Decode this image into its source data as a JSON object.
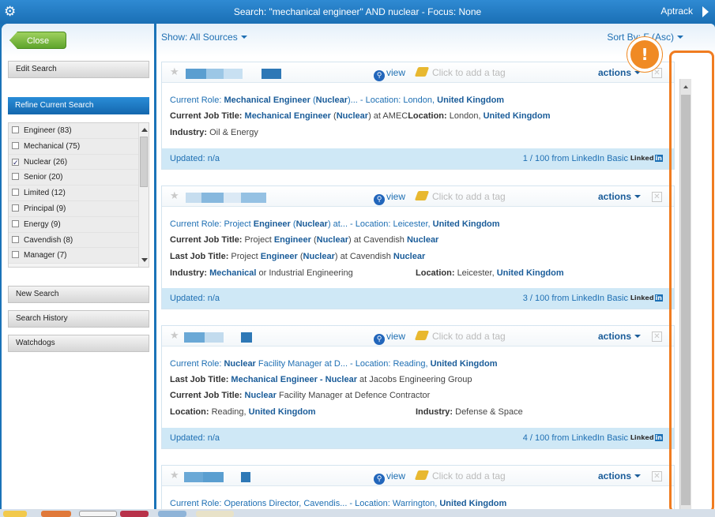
{
  "titlebar": {
    "title": "Search: \"mechanical engineer\" AND nuclear - Focus: None",
    "brand": "Aptrack"
  },
  "sidebar": {
    "close_label": "Close",
    "edit_search": "Edit Search",
    "refine_search": "Refine Current Search",
    "facets": [
      {
        "label": "Engineer (83)",
        "checked": false
      },
      {
        "label": "Mechanical (75)",
        "checked": false
      },
      {
        "label": "Nuclear (26)",
        "checked": true
      },
      {
        "label": "Senior (20)",
        "checked": false
      },
      {
        "label": "Limited (12)",
        "checked": false
      },
      {
        "label": "Principal (9)",
        "checked": false
      },
      {
        "label": "Energy (9)",
        "checked": false
      },
      {
        "label": "Cavendish (8)",
        "checked": false
      },
      {
        "label": "Manager (7)",
        "checked": false
      }
    ],
    "new_search": "New Search",
    "search_history": "Search History",
    "watchdogs": "Watchdogs"
  },
  "toolbar": {
    "sources": "Show: All Sources",
    "sort_by": "Sort By: F",
    "sort_by_tail": "(Asc)"
  },
  "card_common": {
    "view": "view",
    "tag_placeholder": "Click to add a tag",
    "actions": "actions",
    "updated": "Updated: n/a",
    "linkedin_a": "Linked",
    "linkedin_b": "in"
  },
  "cards": [
    {
      "rank": "1 / 100 from LinkedIn Basic"
    },
    {
      "rank": "3 / 100 from LinkedIn Basic"
    },
    {
      "rank": "4 / 100 from LinkedIn Basic"
    },
    {
      "rank": ""
    }
  ],
  "warning_icon": "!",
  "colors": {
    "accent": "#1e6fb3",
    "highlight": "#f07c20",
    "footer": "#cfe8f6"
  }
}
